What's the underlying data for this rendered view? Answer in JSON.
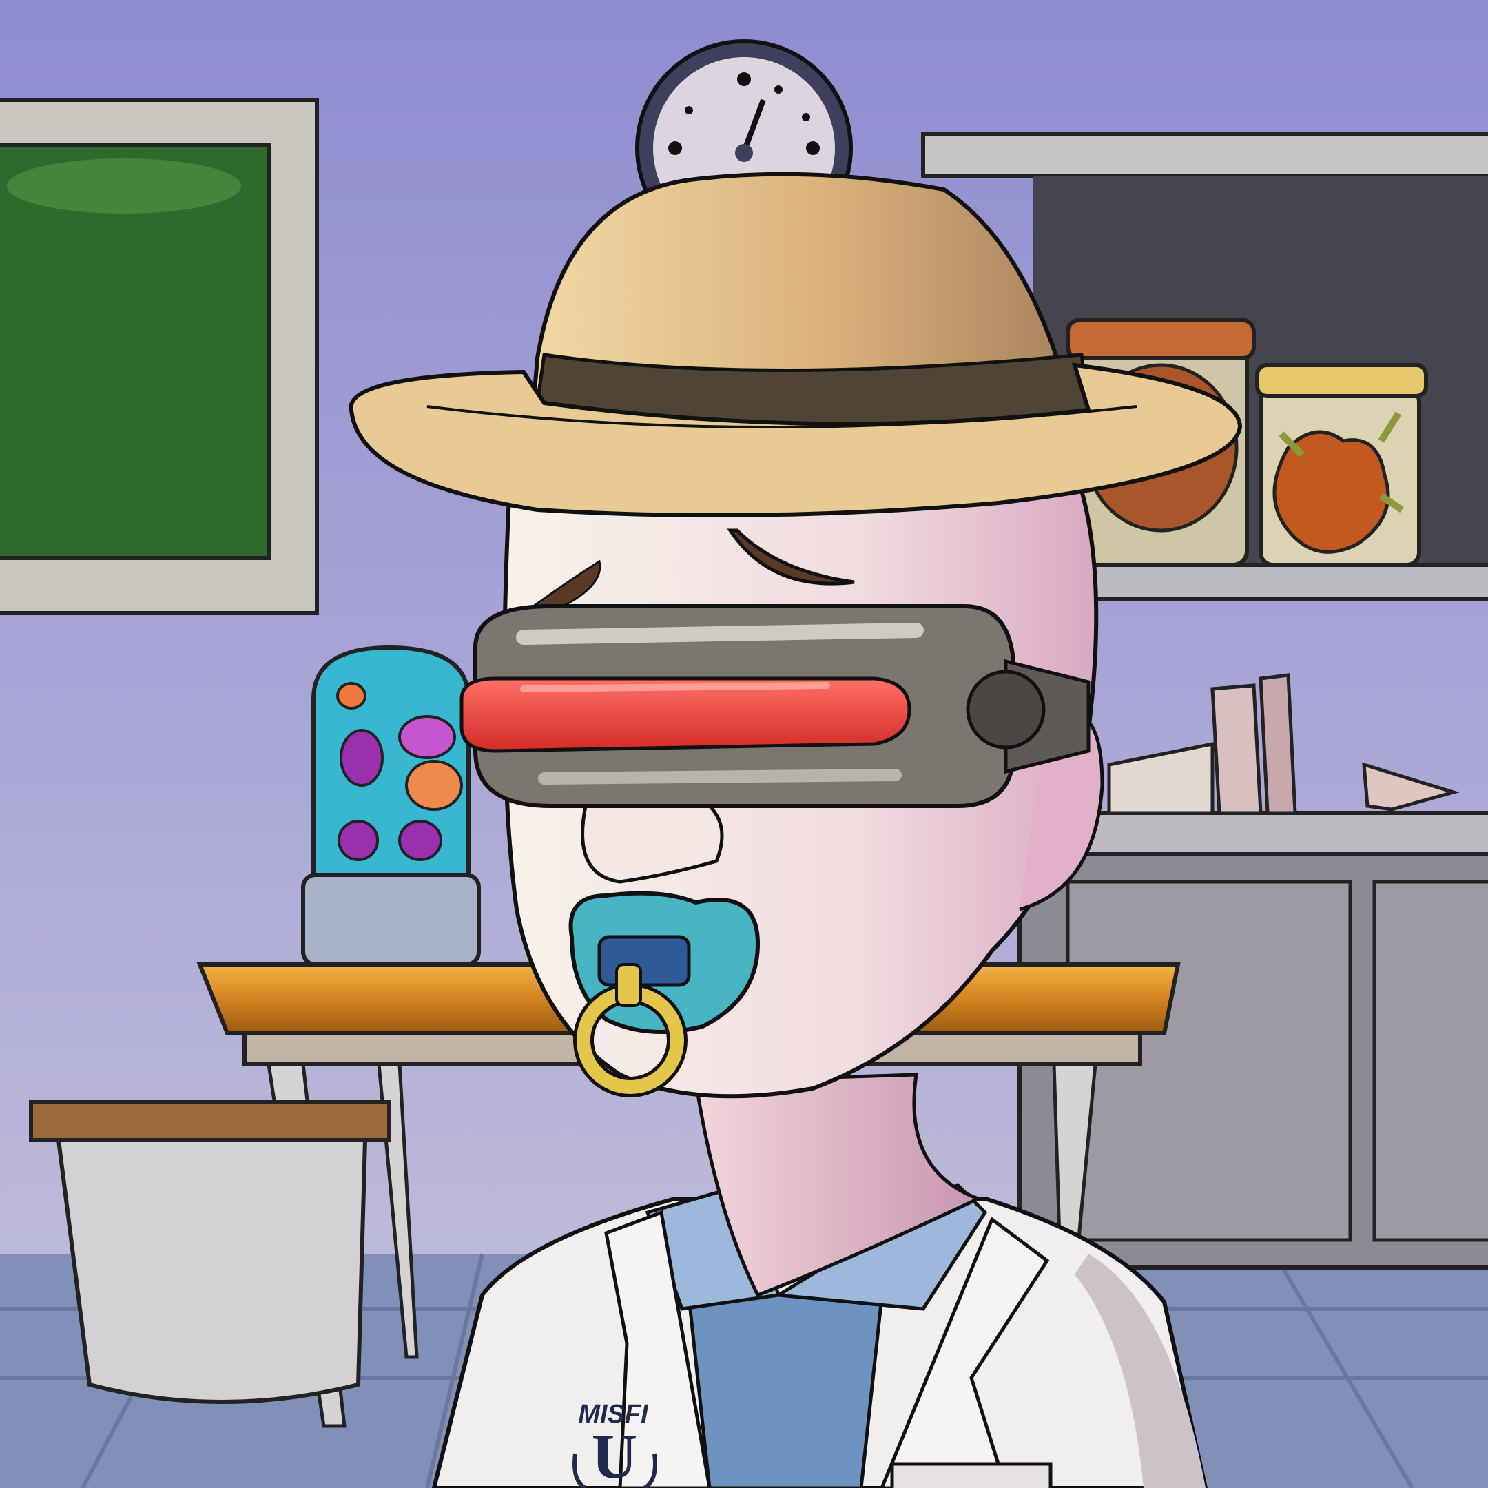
{
  "scene": {
    "subject": "cartoon-character",
    "colors": {
      "wall_top": "#8f8cd1",
      "wall_bottom": "#b4b1d8",
      "floor": "#7f8fb8",
      "chalkboard": "#2f6a2c",
      "frame": "#c9c6c0",
      "hat": "#e2c08a",
      "hat_band": "#4f4436",
      "visor_lens": "#f0423c",
      "visor_body": "#7b7670",
      "skin": "#f3e8e2",
      "pacifier": "#48b5c4",
      "pacifier_ring": "#e3c64a",
      "lab_coat": "#f1eeee",
      "shirt": "#6f93c0",
      "table_top": "#d98a1c",
      "lava_lamp": "#38b7d0",
      "jar_lid": "#e6c86a"
    }
  },
  "badge": {
    "line1": "MISFI",
    "letter": "U"
  }
}
